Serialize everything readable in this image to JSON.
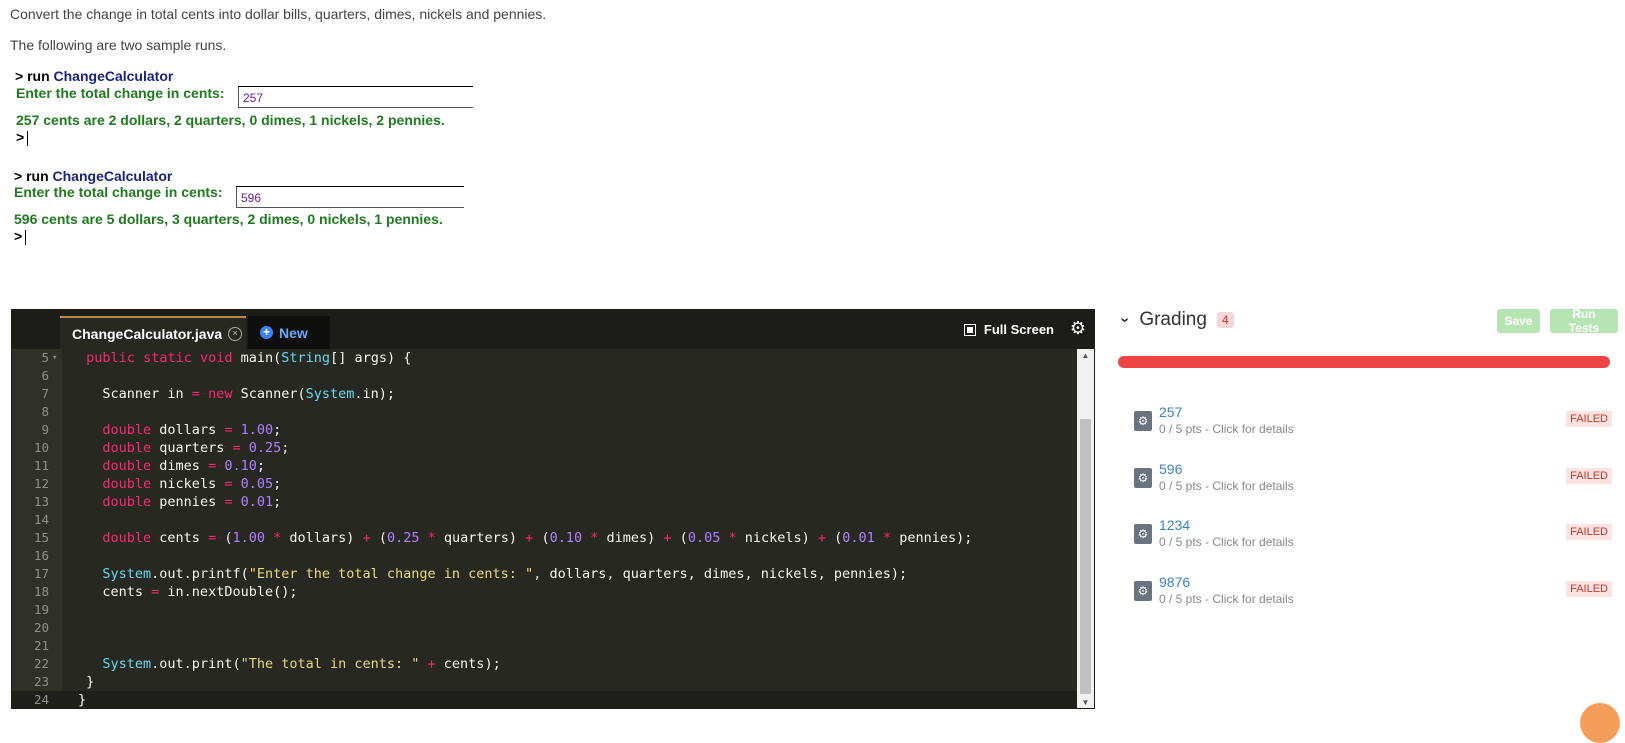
{
  "intro": {
    "line1": "Convert the change in total cents into dollar bills, quarters, dimes, nickels and pennies.",
    "line2": "The following are two sample runs."
  },
  "runs": [
    {
      "cmd": "> run ",
      "cls": "ChangeCalculator",
      "prompt": "Enter the total change in cents:",
      "input": "257",
      "result": "257 cents are 2 dollars, 2 quarters, 0 dimes, 1 nickels, 2 pennies.",
      "cursor": ">"
    },
    {
      "cmd": "> run ",
      "cls": "ChangeCalculator",
      "prompt": "Enter the total change in cents:",
      "input": "596",
      "result": "596 cents are 5 dollars, 3 quarters, 2 dimes, 0 nickels, 1 pennies.",
      "cursor": ">"
    }
  ],
  "editor": {
    "tab_file": "ChangeCalculator.java",
    "tab_close": "×",
    "tab_new": "New",
    "fullscreen": "Full Screen",
    "line_numbers": [
      "5",
      "6",
      "7",
      "8",
      "9",
      "10",
      "11",
      "12",
      "13",
      "14",
      "15",
      "16",
      "17",
      "18",
      "19",
      "20",
      "21",
      "22",
      "23",
      "24"
    ]
  },
  "grading": {
    "title": "Grading",
    "count": "4",
    "save": "Save",
    "run_tests": "Run Tests",
    "progress_fraction": 0,
    "tests": [
      {
        "name": "257",
        "detail": "0 / 5 pts - Click for details",
        "status": "FAILED"
      },
      {
        "name": "596",
        "detail": "0 / 5 pts - Click for details",
        "status": "FAILED"
      },
      {
        "name": "1234",
        "detail": "0 / 5 pts - Click for details",
        "status": "FAILED"
      },
      {
        "name": "9876",
        "detail": "0 / 5 pts - Click for details",
        "status": "FAILED"
      }
    ]
  }
}
